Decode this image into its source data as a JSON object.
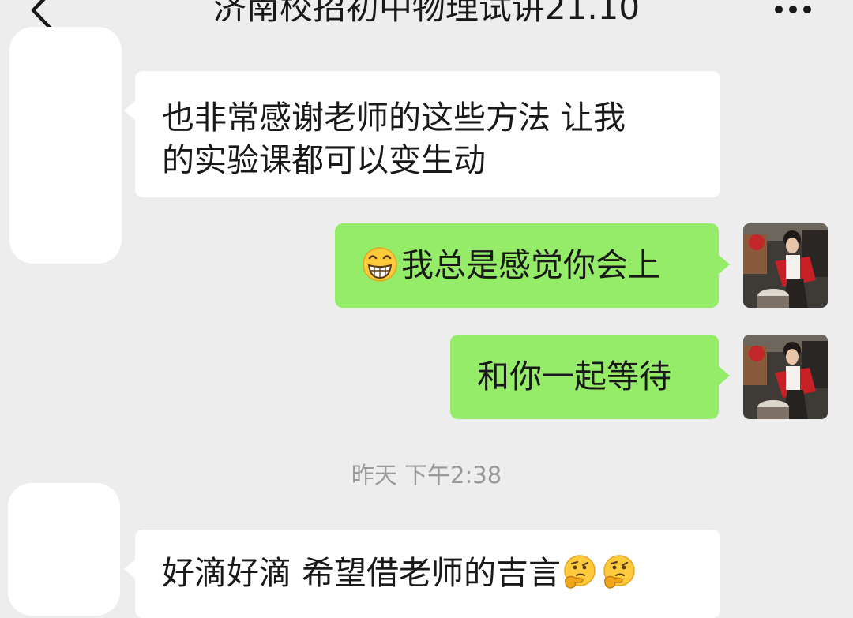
{
  "header": {
    "title": "济南校招初中物理试讲21.10",
    "back_icon": "chevron-left-icon",
    "more_icon": "ellipsis-icon"
  },
  "messages": [
    {
      "side": "left",
      "lines": [
        "也非常感谢老师的这些方法 让我",
        "的实验课都可以变生动"
      ]
    },
    {
      "side": "right",
      "emoji": "grin-emoji-icon",
      "text": "我总是感觉你会上"
    },
    {
      "side": "right",
      "text": "和你一起等待"
    },
    {
      "side": "left",
      "text": "好滴好滴 希望借老师的吉言",
      "trailing_emoji": [
        "thinking-emoji-icon",
        "thinking-emoji-icon"
      ]
    }
  ],
  "timestamp": "昨天 下午2:38",
  "colors": {
    "background": "#ededed",
    "incoming_bubble": "#ffffff",
    "outgoing_bubble": "#95ec69",
    "timestamp_text": "#999999"
  }
}
